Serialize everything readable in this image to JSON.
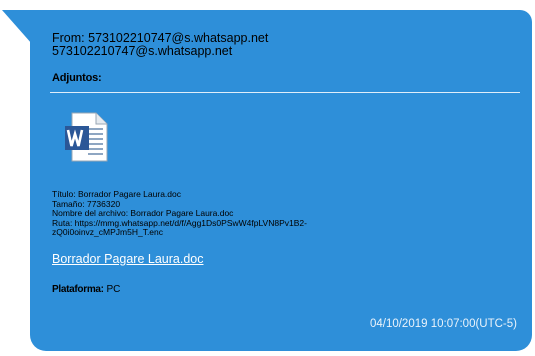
{
  "message": {
    "from_label": "From:",
    "from_address": "573102210747@s.whatsapp.net",
    "from_name": "573102210747@s.whatsapp.net"
  },
  "attachments": {
    "heading": "Adjuntos:",
    "icon": "word-document-icon",
    "title_line": "Título: Borrador Pagare Laura.doc",
    "size_line": "Tamaño: 7736320",
    "filename_line": "Nombre del archivo: Borrador Pagare Laura.doc",
    "path_line_1": "Ruta: https://mmg.whatsapp.net/d/f/Agg1Ds0PSwW4fpLVN8Pv1B2-",
    "path_line_2": "zQ0i0oinvz_cMPJm5H_T.enc",
    "link_label": "Borrador Pagare Laura.doc"
  },
  "platform": {
    "label": "Plataforma:",
    "value": "PC"
  },
  "timestamp": "04/10/2019 10:07:00(UTC-5)",
  "colors": {
    "bubble": "#2e8fd9",
    "text": "#ffffff",
    "word_blue": "#2b5797"
  }
}
